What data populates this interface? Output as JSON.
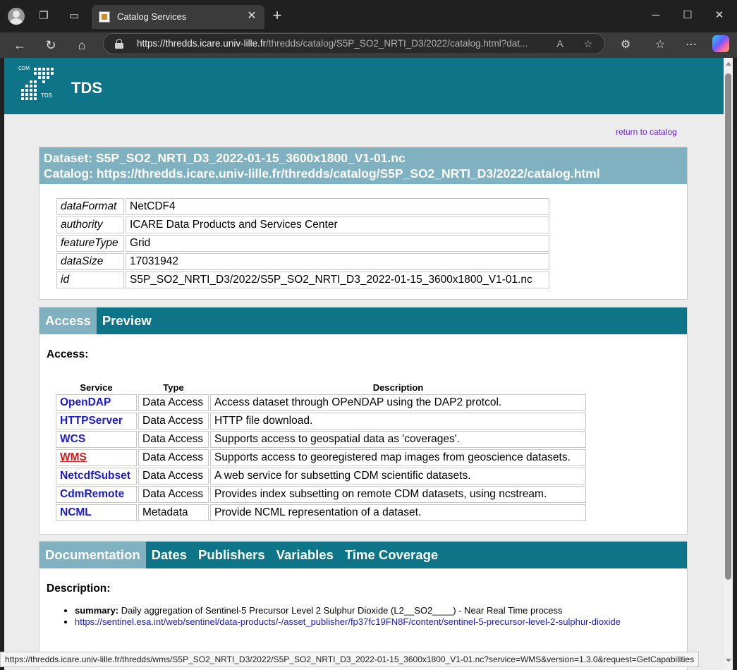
{
  "browser": {
    "tab_title": "Catalog Services",
    "url_host": "https://thredds.icare.univ-lille.fr",
    "url_path": "/thredds/catalog/S5P_SO2_NRTI_D3/2022/catalog.html?dat...",
    "status_url": "https://thredds.icare.univ-lille.fr/thredds/wms/S5P_SO2_NRTI_D3/2022/S5P_SO2_NRTI_D3_2022-01-15_3600x1800_V1-01.nc?service=WMS&version=1.3.0&request=GetCapabilities"
  },
  "header": {
    "logo_top": "CDM",
    "logo_bottom": "TDS",
    "title": "TDS"
  },
  "return_link": "return to catalog",
  "dataset": {
    "line1": "Dataset: S5P_SO2_NRTI_D3_2022-01-15_3600x1800_V1-01.nc",
    "line2": "Catalog: https://thredds.icare.univ-lille.fr/thredds/catalog/S5P_SO2_NRTI_D3/2022/catalog.html",
    "properties": [
      {
        "key": "dataFormat",
        "value": "NetCDF4"
      },
      {
        "key": "authority",
        "value": "ICARE Data Products and Services Center"
      },
      {
        "key": "featureType",
        "value": "Grid"
      },
      {
        "key": "dataSize",
        "value": "17031942"
      },
      {
        "key": "id",
        "value": "S5P_SO2_NRTI_D3/2022/S5P_SO2_NRTI_D3_2022-01-15_3600x1800_V1-01.nc"
      }
    ]
  },
  "access_tabs": [
    "Access",
    "Preview"
  ],
  "access": {
    "heading": "Access:",
    "columns": [
      "Service",
      "Type",
      "Description"
    ],
    "rows": [
      {
        "service": "OpenDAP",
        "type": "Data Access",
        "description": "Access dataset through OPeNDAP using the DAP2 protcol."
      },
      {
        "service": "HTTPServer",
        "type": "Data Access",
        "description": "HTTP file download."
      },
      {
        "service": "WCS",
        "type": "Data Access",
        "description": "Supports access to geospatial data as 'coverages'."
      },
      {
        "service": "WMS",
        "type": "Data Access",
        "description": "Supports access to georegistered map images from geoscience datasets."
      },
      {
        "service": "NetcdfSubset",
        "type": "Data Access",
        "description": "A web service for subsetting CDM scientific datasets."
      },
      {
        "service": "CdmRemote",
        "type": "Data Access",
        "description": "Provides index subsetting on remote CDM datasets, using ncstream."
      },
      {
        "service": "NCML",
        "type": "Metadata",
        "description": "Provide NCML representation of a dataset."
      }
    ]
  },
  "doc_tabs": [
    "Documentation",
    "Dates",
    "Publishers",
    "Variables",
    "Time Coverage"
  ],
  "documentation": {
    "heading": "Description:",
    "summary_label": "summary:",
    "summary_text": " Daily aggregation of Sentinel-5 Precursor Level 2 Sulphur Dioxide (L2__SO2____) - Near Real Time process",
    "link": "https://sentinel.esa.int/web/sentinel/data-products/-/asset_publisher/fp37fc19FN8F/content/sentinel-5-precursor-level-2-sulphur-dioxide"
  },
  "colors": {
    "header_teal": "#0e7487",
    "panel_light": "#7fb1c0",
    "link_blue": "#1a1ad6",
    "visited_red": "#d41a1a",
    "return_purple": "#6a22d1"
  }
}
